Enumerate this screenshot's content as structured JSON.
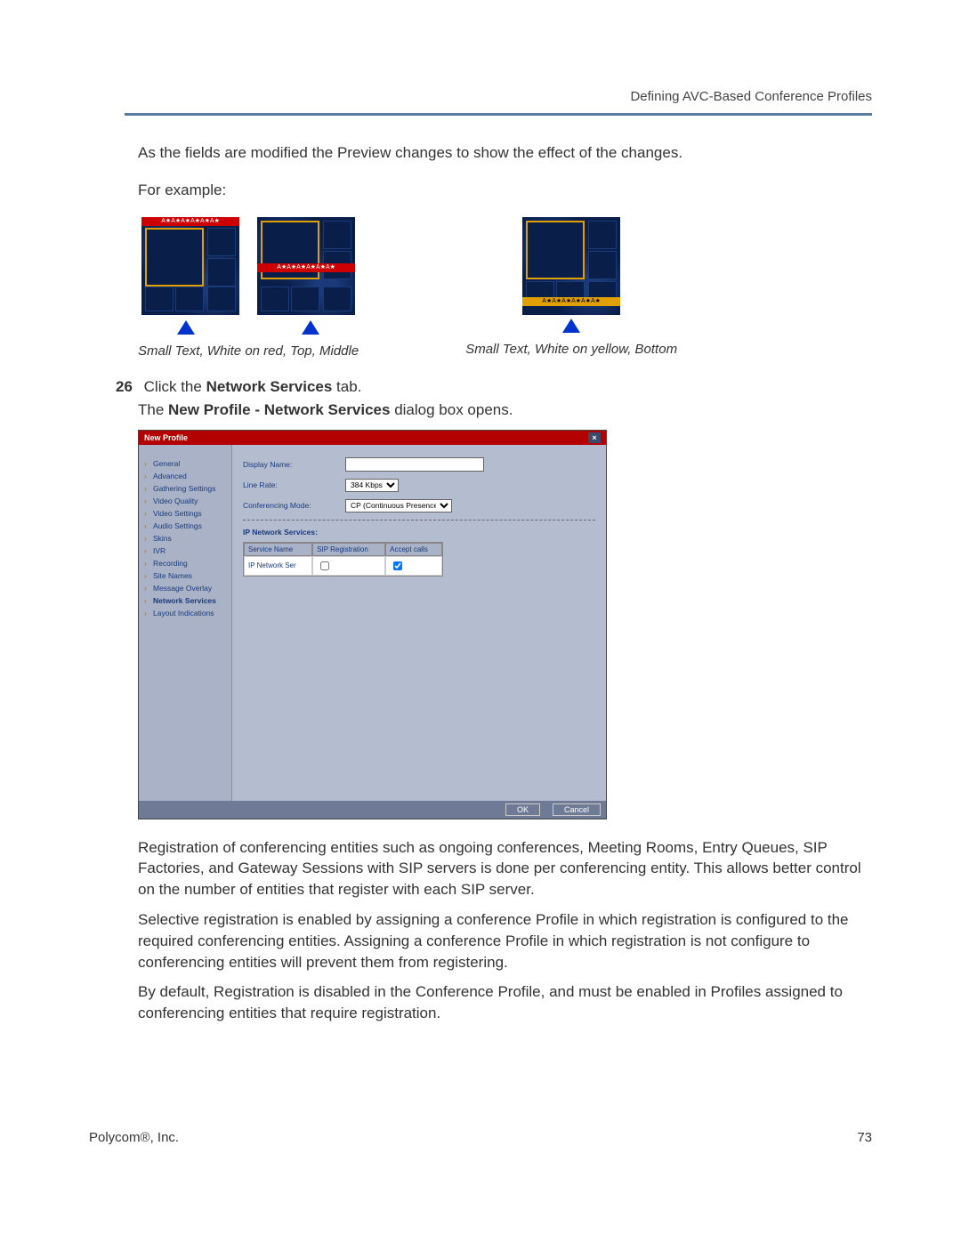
{
  "header": {
    "section_title": "Defining AVC-Based Conference Profiles"
  },
  "intro": {
    "line1": "As the fields are modified the Preview changes to show the effect of the changes.",
    "line2": "For example:"
  },
  "captions": {
    "left": "Small Text, White on red, Top, Middle",
    "right": "Small Text, White on yellow, Bottom"
  },
  "strip_text": "A★A★A★A★A★A★",
  "step": {
    "number": "26",
    "text_prefix": "Click the ",
    "text_bold": "Network Services",
    "text_suffix": " tab.",
    "sub_prefix": "The ",
    "sub_bold": "New Profile - Network Services",
    "sub_suffix": " dialog box opens."
  },
  "dialog": {
    "title": "New Profile",
    "nav_items": [
      "General",
      "Advanced",
      "Gathering Settings",
      "Video Quality",
      "Video Settings",
      "Audio Settings",
      "Skins",
      "IVR",
      "Recording",
      "Site Names",
      "Message Overlay",
      "Network Services",
      "Layout Indications"
    ],
    "nav_active_index": 11,
    "fields": {
      "display_name_label": "Display Name:",
      "display_name_value": "",
      "line_rate_label": "Line Rate:",
      "line_rate_value": "384 Kbps",
      "conf_mode_label": "Conferencing Mode:",
      "conf_mode_value": "CP (Continuous Presence)"
    },
    "section_head": "IP Network Services:",
    "table": {
      "headers": [
        "Service Name",
        "SIP Registration",
        "Accept calls"
      ],
      "row": {
        "service_name": "IP Network Ser",
        "sip_registration": false,
        "accept_calls": true
      }
    },
    "buttons": {
      "ok": "OK",
      "cancel": "Cancel"
    }
  },
  "paragraphs": {
    "p1": "Registration of conferencing entities such as ongoing conferences, Meeting Rooms, Entry Queues, SIP Factories, and Gateway Sessions with SIP servers is done per conferencing entity. This allows better control on the number of entities that register with each SIP server.",
    "p2": "Selective registration is enabled by assigning a conference Profile in which registration is configured to the required conferencing entities. Assigning a conference Profile in which registration is not configure to conferencing entities will prevent them from registering.",
    "p3": "By default, Registration is disabled in the Conference Profile, and must be enabled in Profiles assigned to conferencing entities that require registration."
  },
  "footer": {
    "left": "Polycom®, Inc.",
    "right": "73"
  }
}
